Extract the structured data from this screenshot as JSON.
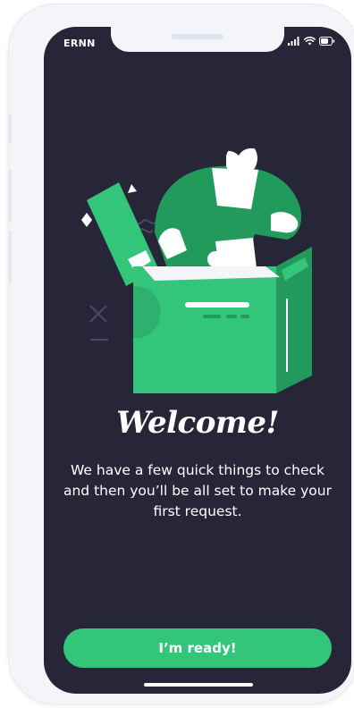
{
  "status_bar": {
    "carrier": "ERNN",
    "icons": [
      "cellular-signal-icon",
      "wifi-icon",
      "battery-icon"
    ]
  },
  "onboarding": {
    "title": "Welcome!",
    "message": "We have a few quick things to check and then you’ll be all set to make your first request.",
    "primary_button_label": "I’m ready!"
  },
  "colors": {
    "background": "#272638",
    "accent": "#33c67a",
    "accent_dark": "#229a5c",
    "text": "#ffffff"
  }
}
